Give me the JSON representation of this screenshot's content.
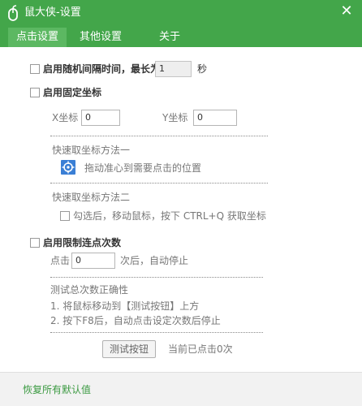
{
  "window": {
    "title": "鼠大侠-设置",
    "close_glyph": "✕"
  },
  "tabs": [
    {
      "label": "点击设置",
      "active": true
    },
    {
      "label": "其他设置",
      "active": false
    },
    {
      "label": "关于",
      "active": false
    }
  ],
  "random_interval": {
    "label": "启用随机间隔时间，最长为",
    "value": "1",
    "unit": "秒",
    "checked": false
  },
  "fixed_coords": {
    "label": "启用固定坐标",
    "checked": false,
    "x_label": "X坐标",
    "x_value": "0",
    "y_label": "Y坐标",
    "y_value": "0",
    "method1_title": "快速取坐标方法一",
    "method1_text": "拖动准心到需要点击的位置",
    "method2_title": "快速取坐标方法二",
    "method2_text": "勾选后，移动鼠标，按下 CTRL+Q 获取坐标",
    "method2_checked": false
  },
  "limit_clicks": {
    "label": "启用限制连点次数",
    "checked": false,
    "click_label": "点击",
    "click_value": "0",
    "after_text": "次后，自动停止",
    "test_title": "测试总次数正确性",
    "step1": "1. 将鼠标移动到【测试按钮】上方",
    "step2": "2. 按下F8后，自动点击设定次数后停止",
    "test_button": "测试按钮",
    "current_count": "当前已点击0次"
  },
  "footer": {
    "reset_label": "恢复所有默认值"
  },
  "colors": {
    "accent": "#43a64a",
    "active_tab": "#5cb862",
    "link": "#3b9a41"
  },
  "icons": {
    "logo": "mouse-logo-icon",
    "target": "crosshair-icon"
  }
}
